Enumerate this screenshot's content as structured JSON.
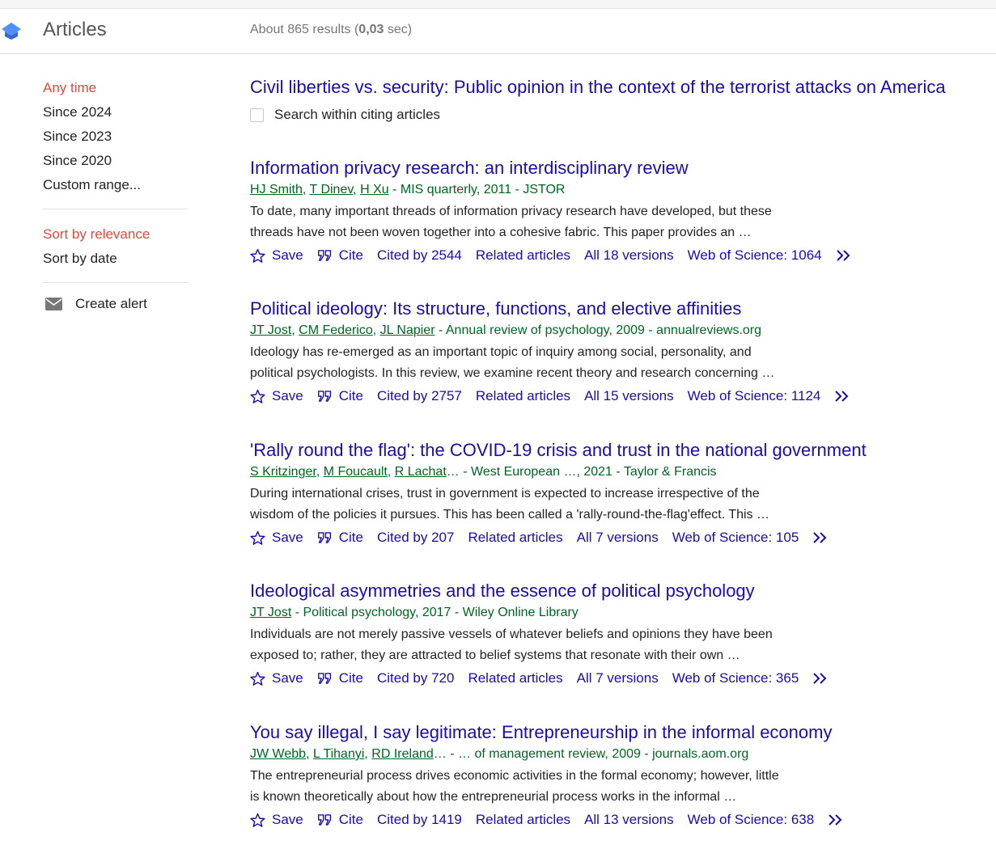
{
  "header": {
    "section_title": "Articles",
    "results_prefix": "About 865 results (",
    "results_time": "0,03",
    "results_suffix": " sec)"
  },
  "sidebar": {
    "time_filters": [
      "Any time",
      "Since 2024",
      "Since 2023",
      "Since 2020",
      "Custom range..."
    ],
    "sort_options": [
      "Sort by relevance",
      "Sort by date"
    ],
    "create_alert": "Create alert"
  },
  "cited_article": {
    "title": "Civil liberties vs. security: Public opinion in the context of the terrorist attacks on America",
    "search_within_label": "Search within citing articles"
  },
  "actions": {
    "save": "Save",
    "cite": "Cite",
    "related": "Related articles"
  },
  "results": [
    {
      "title": "Information privacy research: an interdisciplinary review",
      "authors": [
        "HJ Smith",
        "T Dinev",
        "H Xu"
      ],
      "authors_trail": "",
      "source": " - MIS quarterly, 2011 - JSTOR",
      "snippet_line1": "To date, many important threads of information privacy research have developed, but these",
      "snippet_line2": "threads have not been woven together into a cohesive fabric. This paper provides an …",
      "cited_by": "Cited by 2544",
      "versions": "All 18 versions",
      "wos": "Web of Science: 1064"
    },
    {
      "title": "Political ideology: Its structure, functions, and elective affinities",
      "authors": [
        "JT Jost",
        "CM Federico",
        "JL Napier"
      ],
      "authors_trail": "",
      "source": " - Annual review of psychology, 2009 - annualreviews.org",
      "snippet_line1": "Ideology has re-emerged as an important topic of inquiry among social, personality, and",
      "snippet_line2": "political psychologists. In this review, we examine recent theory and research concerning …",
      "cited_by": "Cited by 2757",
      "versions": "All 15 versions",
      "wos": "Web of Science: 1124"
    },
    {
      "title": "'Rally round the flag': the COVID-19 crisis and trust in the national government",
      "authors": [
        "S Kritzinger",
        "M Foucault",
        "R Lachat"
      ],
      "authors_trail": "…",
      "source": " - West European …, 2021 - Taylor & Francis",
      "snippet_line1": "During international crises, trust in government is expected to increase irrespective of the",
      "snippet_line2": "wisdom of the policies it pursues. This has been called a 'rally-round-the-flag'effect. This …",
      "cited_by": "Cited by 207",
      "versions": "All 7 versions",
      "wos": "Web of Science: 105"
    },
    {
      "title": "Ideological asymmetries and the essence of political psychology",
      "authors": [
        "JT Jost"
      ],
      "authors_trail": "",
      "source": " - Political psychology, 2017 - Wiley Online Library",
      "snippet_line1": "Individuals are not merely passive vessels of whatever beliefs and opinions they have been",
      "snippet_line2": "exposed to; rather, they are attracted to belief systems that resonate with their own …",
      "cited_by": "Cited by 720",
      "versions": "All 7 versions",
      "wos": "Web of Science: 365"
    },
    {
      "title": "You say illegal, I say legitimate: Entrepreneurship in the informal economy",
      "authors": [
        "JW Webb",
        "L Tihanyi",
        "RD Ireland"
      ],
      "authors_trail": "…",
      "source": " - … of management review, 2009 - journals.aom.org",
      "snippet_line1": "The entrepreneurial process drives economic activities in the formal economy; however, little",
      "snippet_line2": "is known theoretically about how the entrepreneurial process works in the informal …",
      "cited_by": "Cited by 1419",
      "versions": "All 13 versions",
      "wos": "Web of Science: 638"
    }
  ],
  "colors": {
    "link": "#1a0dab",
    "meta_green": "#006621",
    "active_red": "#dd4b39"
  }
}
